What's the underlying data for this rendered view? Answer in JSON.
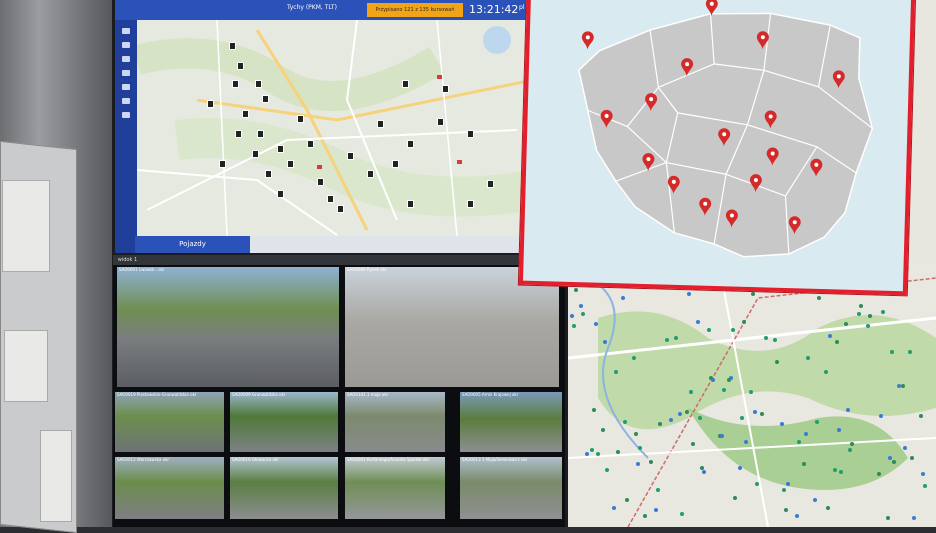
{
  "control_screen": {
    "title": "Tychy (PKM, TLT)",
    "counter_text": "Przypisano 121 z 135 kursowań",
    "clock": "13:21:42",
    "lang": "pl",
    "bottom_tab": "Pojazdy"
  },
  "camera_screen": {
    "header_left": "widok 1",
    "cameras": [
      {
        "label": "SAO0001 Lwowsk...okr"
      },
      {
        "label": "SAO0006 Rynek okr"
      },
      {
        "label": "SAO0019 Piastowskie-Grunwaldzkie okr"
      },
      {
        "label": "SAO0009 Grunwaldzka okr"
      },
      {
        "label": "SAO0141 1 maja okr"
      },
      {
        "label": "SAO0005 Armii Krajowej okr"
      },
      {
        "label": "SAO0012 Warszawska okr"
      },
      {
        "label": "SAO0016 Głowacka okr"
      },
      {
        "label": "SAO0001 Korfantego/Arnolda Spodek okr"
      },
      {
        "label": "SAO0013 1 Maja/Sienkiewicz okr"
      }
    ]
  },
  "poland_map": {
    "border_color": "#e41e2b",
    "region_color": "#c8c8c8",
    "marker_color": "#d42a2a",
    "marker_count": 17
  },
  "colors": {
    "app_blue": "#2a52b8",
    "counter_orange": "#f2a417"
  }
}
